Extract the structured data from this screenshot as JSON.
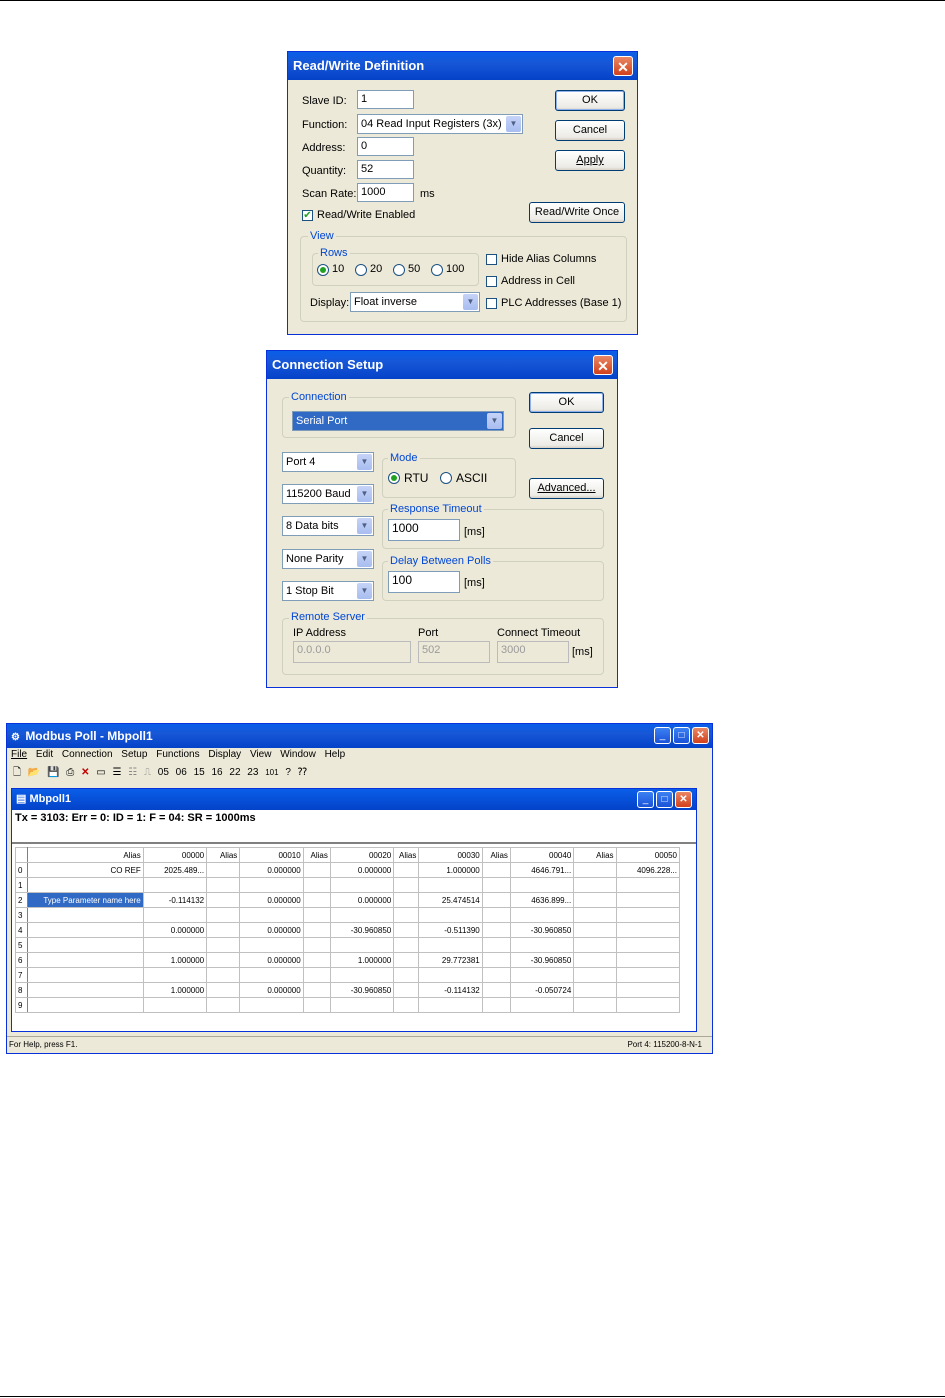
{
  "rw_dialog": {
    "title": "Read/Write Definition",
    "close": "✕",
    "slave_id_label": "Slave ID:",
    "slave_id": "1",
    "function_label": "Function:",
    "function_value": "04 Read Input Registers (3x)",
    "address_label": "Address:",
    "address": "0",
    "quantity_label": "Quantity:",
    "quantity": "52",
    "scan_rate_label": "Scan Rate:",
    "scan_rate": "1000",
    "scan_rate_unit": "ms",
    "rw_enabled_label": "Read/Write Enabled",
    "rw_enabled_checked": true,
    "ok": "OK",
    "cancel": "Cancel",
    "apply": "Apply",
    "rw_once": "Read/Write Once",
    "view_group": "View",
    "rows_group": "Rows",
    "rows_options": [
      "10",
      "20",
      "50",
      "100"
    ],
    "rows_selected": "10",
    "display_label": "Display:",
    "display_value": "Float inverse",
    "hide_alias_label": "Hide Alias Columns",
    "address_in_cell_label": "Address in Cell",
    "plc_addresses_label": "PLC Addresses (Base 1)"
  },
  "conn_dialog": {
    "title": "Connection Setup",
    "close": "✕",
    "connection_group": "Connection",
    "connection_value": "Serial Port",
    "ok": "OK",
    "cancel": "Cancel",
    "advanced": "Advanced...",
    "port": "Port 4",
    "baud": "115200 Baud",
    "data_bits": "8 Data bits",
    "parity": "None Parity",
    "stop_bits": "1 Stop Bit",
    "mode_group": "Mode",
    "mode_rtu": "RTU",
    "mode_ascii": "ASCII",
    "mode_selected": "RTU",
    "response_timeout_group": "Response Timeout",
    "response_timeout": "1000",
    "response_timeout_unit": "[ms]",
    "delay_group": "Delay Between Polls",
    "delay": "100",
    "delay_unit": "[ms]",
    "remote_group": "Remote Server",
    "ip_label": "IP Address",
    "ip_value": "0.0.0.0",
    "port_label": "Port",
    "port_value": "502",
    "connect_timeout_label": "Connect Timeout",
    "connect_timeout_value": "3000",
    "connect_timeout_unit": "[ms]"
  },
  "modbus": {
    "title": "Modbus Poll - Mbpoll1",
    "menu": [
      "File",
      "Edit",
      "Connection",
      "Setup",
      "Functions",
      "Display",
      "View",
      "Window",
      "Help"
    ],
    "toolbar_codes": [
      "05",
      "06",
      "15",
      "16",
      "22",
      "23",
      "101"
    ],
    "child_title": "Mbpoll1",
    "status_line": "Tx = 3103: Err = 0: ID = 1: F = 04: SR = 1000ms",
    "headers": [
      "Alias",
      "00000",
      "Alias",
      "00010",
      "Alias",
      "00020",
      "Alias",
      "00030",
      "Alias",
      "00040",
      "Alias",
      "00050"
    ],
    "rows": [
      [
        "0",
        "CO REF",
        "2025.489...",
        "",
        "0.000000",
        "",
        "0.000000",
        "",
        "1.000000",
        "",
        "4646.791...",
        "",
        "4096.228..."
      ],
      [
        "1",
        "",
        "",
        "",
        "",
        "",
        "",
        "",
        "",
        "",
        "",
        "",
        ""
      ],
      [
        "2",
        "Type Parameter name here",
        "-0.114132",
        "",
        "0.000000",
        "",
        "0.000000",
        "",
        "25.474514",
        "",
        "4636.899...",
        "",
        ""
      ],
      [
        "3",
        "",
        "",
        "",
        "",
        "",
        "",
        "",
        "",
        "",
        "",
        "",
        ""
      ],
      [
        "4",
        "",
        "0.000000",
        "",
        "0.000000",
        "",
        "-30.960850",
        "",
        "-0.511390",
        "",
        "-30.960850",
        "",
        ""
      ],
      [
        "5",
        "",
        "",
        "",
        "",
        "",
        "",
        "",
        "",
        "",
        "",
        "",
        ""
      ],
      [
        "6",
        "",
        "1.000000",
        "",
        "0.000000",
        "",
        "1.000000",
        "",
        "29.772381",
        "",
        "-30.960850",
        "",
        ""
      ],
      [
        "7",
        "",
        "",
        "",
        "",
        "",
        "",
        "",
        "",
        "",
        "",
        "",
        ""
      ],
      [
        "8",
        "",
        "1.000000",
        "",
        "0.000000",
        "",
        "-30.960850",
        "",
        "-0.114132",
        "",
        "-0.050724",
        "",
        ""
      ],
      [
        "9",
        "",
        "",
        "",
        "",
        "",
        "",
        "",
        "",
        "",
        "",
        "",
        ""
      ]
    ],
    "status_left": "For Help, press F1.",
    "status_right": "Port 4: 115200-8-N-1"
  }
}
